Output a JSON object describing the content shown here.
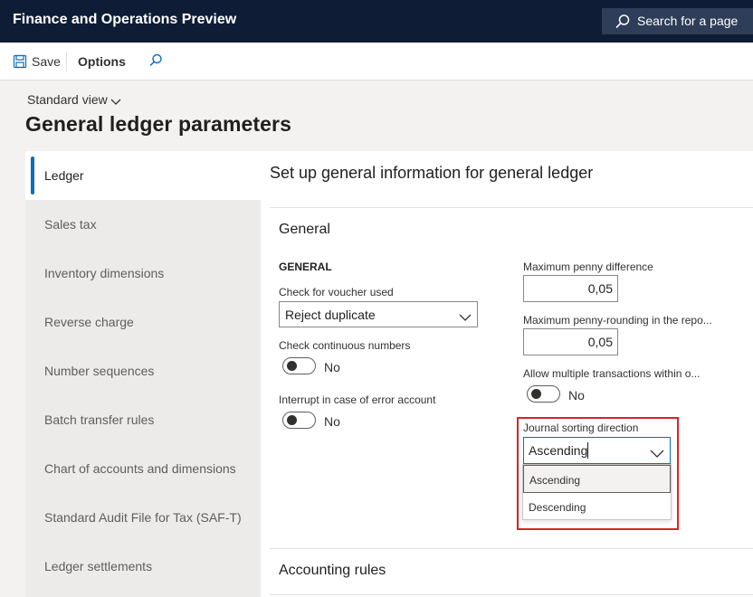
{
  "header": {
    "app_title": "Finance and Operations Preview",
    "search_label": "Search for a page"
  },
  "actions": {
    "save": "Save",
    "options": "Options"
  },
  "page": {
    "view_selector": "Standard view",
    "title": "General ledger parameters"
  },
  "nav": {
    "items": [
      {
        "label": "Ledger",
        "active": true
      },
      {
        "label": "Sales tax"
      },
      {
        "label": "Inventory dimensions"
      },
      {
        "label": "Reverse charge"
      },
      {
        "label": "Number sequences"
      },
      {
        "label": "Batch transfer rules"
      },
      {
        "label": "Chart of accounts and dimensions"
      },
      {
        "label": "Standard Audit File for Tax (SAF-T)"
      },
      {
        "label": "Ledger settlements"
      }
    ]
  },
  "main": {
    "header": "Set up general information for general ledger",
    "general": {
      "title": "General",
      "subhead": "GENERAL",
      "voucher_label": "Check for voucher used",
      "voucher_value": "Reject duplicate",
      "continuous_label": "Check continuous numbers",
      "continuous_value": "No",
      "interrupt_label": "Interrupt in case of error account",
      "interrupt_value": "No",
      "max_penny_label": "Maximum penny difference",
      "max_penny_value": "0,05",
      "max_penny_round_label": "Maximum penny-rounding in the repo...",
      "max_penny_round_value": "0,05",
      "allow_multi_label": "Allow multiple transactions within o...",
      "allow_multi_value": "No",
      "journal_sort_label": "Journal sorting direction",
      "journal_sort_value": "Ascending",
      "journal_sort_options": [
        "Ascending",
        "Descending"
      ]
    },
    "accounting_rules_title": "Accounting rules"
  },
  "colors": {
    "topbar": "#0e1d35",
    "accent": "#0f6cbd",
    "highlight": "#d7232a"
  }
}
